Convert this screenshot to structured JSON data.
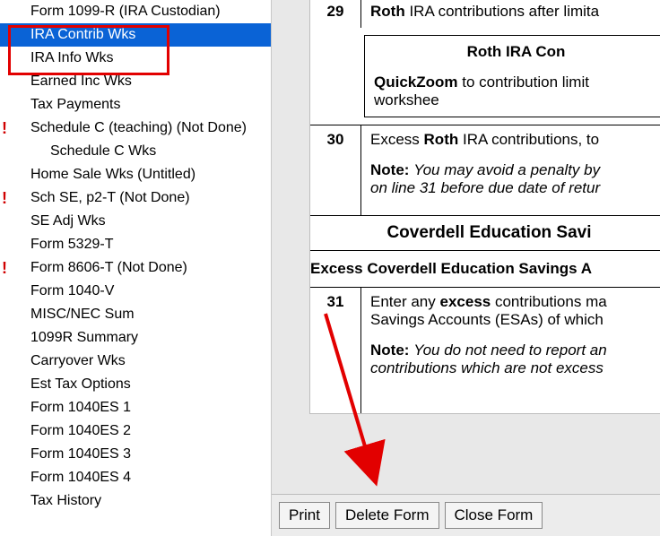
{
  "sidebar": {
    "items": [
      {
        "label": "Form 1099-R (IRA Custodian)",
        "indent": 1,
        "flag": false,
        "selected": false
      },
      {
        "label": "IRA Contrib Wks",
        "indent": 1,
        "flag": false,
        "selected": true
      },
      {
        "label": "IRA Info Wks",
        "indent": 1,
        "flag": false,
        "selected": false
      },
      {
        "label": "Earned Inc Wks",
        "indent": 1,
        "flag": false,
        "selected": false
      },
      {
        "label": "Tax Payments",
        "indent": 1,
        "flag": false,
        "selected": false
      },
      {
        "label": "Schedule C (teaching) (Not Done)",
        "indent": 1,
        "flag": true,
        "selected": false
      },
      {
        "label": "Schedule C Wks",
        "indent": 2,
        "flag": false,
        "selected": false
      },
      {
        "label": "Home Sale Wks (Untitled)",
        "indent": 1,
        "flag": false,
        "selected": false
      },
      {
        "label": "Sch SE, p2-T (Not Done)",
        "indent": 1,
        "flag": true,
        "selected": false
      },
      {
        "label": "SE Adj Wks",
        "indent": 1,
        "flag": false,
        "selected": false
      },
      {
        "label": "Form 5329-T",
        "indent": 1,
        "flag": false,
        "selected": false
      },
      {
        "label": "Form 8606-T (Not Done)",
        "indent": 1,
        "flag": true,
        "selected": false
      },
      {
        "label": "Form 1040-V",
        "indent": 1,
        "flag": false,
        "selected": false
      },
      {
        "label": "MISC/NEC Sum",
        "indent": 1,
        "flag": false,
        "selected": false
      },
      {
        "label": "1099R Summary",
        "indent": 1,
        "flag": false,
        "selected": false
      },
      {
        "label": "Carryover Wks",
        "indent": 1,
        "flag": false,
        "selected": false
      },
      {
        "label": "Est Tax Options",
        "indent": 1,
        "flag": false,
        "selected": false
      },
      {
        "label": "Form 1040ES 1",
        "indent": 1,
        "flag": false,
        "selected": false
      },
      {
        "label": "Form 1040ES 2",
        "indent": 1,
        "flag": false,
        "selected": false
      },
      {
        "label": "Form 1040ES 3",
        "indent": 1,
        "flag": false,
        "selected": false
      },
      {
        "label": "Form 1040ES 4",
        "indent": 1,
        "flag": false,
        "selected": false
      },
      {
        "label": "Tax History",
        "indent": 1,
        "flag": false,
        "selected": false
      }
    ],
    "flag_glyph": "!"
  },
  "form": {
    "line29": {
      "num": "29",
      "text_prefix": "Roth",
      "text_rest": " IRA contributions after limita"
    },
    "box": {
      "title": "Roth IRA Con",
      "qz_label": "QuickZoom",
      "qz_rest": " to contribution limit workshee"
    },
    "line30": {
      "num": "30",
      "p1_pre": "Excess ",
      "p1_bold": "Roth",
      "p1_post": " IRA contributions, to",
      "note_label": "Note:",
      "note_rest": " You may avoid a penalty by",
      "note_line2": "on line 31 before due date of retur"
    },
    "sec_title": "Coverdell Education Savi",
    "sub_title": "Excess Coverdell Education Savings A",
    "line31": {
      "num": "31",
      "p1_pre": "Enter any ",
      "p1_bold": "excess",
      "p1_post": " contributions ma",
      "p2": "Savings Accounts (ESAs) of which",
      "note_label": "Note:",
      "note_rest": " You do not need to report an",
      "note_line2": "contributions which are not excess"
    }
  },
  "buttons": {
    "print": "Print",
    "delete": "Delete Form",
    "close": "Close Form"
  }
}
